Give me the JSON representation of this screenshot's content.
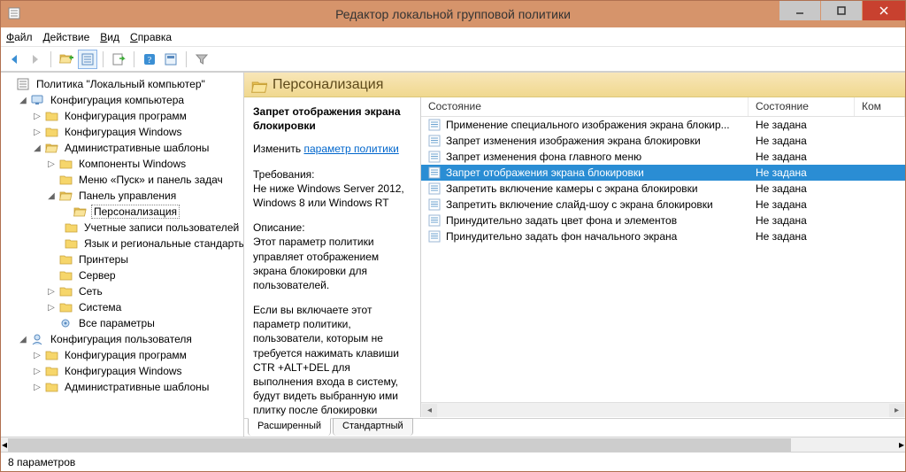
{
  "window": {
    "title": "Редактор локальной групповой политики"
  },
  "menu": {
    "file": "Файл",
    "action": "Действие",
    "view": "Вид",
    "help": "Справка"
  },
  "tree": {
    "root": "Политика \"Локальный компьютер\"",
    "compCfg": "Конфигурация компьютера",
    "softCfg": "Конфигурация программ",
    "winCfg": "Конфигурация Windows",
    "adminTpl": "Административные шаблоны",
    "winComp": "Компоненты Windows",
    "startMenu": "Меню «Пуск» и панель задач",
    "ctrlPanel": "Панель управления",
    "personalization": "Персонализация",
    "userAccounts": "Учетные записи пользователей",
    "langRegion": "Язык и региональные стандарты",
    "printers": "Принтеры",
    "server": "Сервер",
    "network": "Сеть",
    "system": "Система",
    "allSettings": "Все параметры",
    "userCfg": "Конфигурация пользователя",
    "uSoftCfg": "Конфигурация программ",
    "uWinCfg": "Конфигурация Windows",
    "uAdminTpl": "Административные шаблоны"
  },
  "header": {
    "title": "Персонализация"
  },
  "details": {
    "settingName": "Запрет отображения экрана блокировки",
    "editPrefix": "Изменить ",
    "editLink": "параметр политики",
    "reqLabel": "Требования:",
    "reqText": "Не ниже Windows Server 2012, Windows 8 или Windows RT",
    "descLabel": "Описание:",
    "descP1": "Этот параметр политики управляет отображением экрана блокировки для пользователей.",
    "descP2": "Если вы включаете этот параметр политики, пользователи, которым не требуется нажимать клавиши CTR +ALT+DEL для выполнения входа в систему, будут видеть выбранную ими плитку после блокировки своего компьютера."
  },
  "columns": {
    "name": "Состояние",
    "state": "Состояние",
    "comment": "Комментарий",
    "commentShort": "Ком"
  },
  "rows": [
    {
      "name": "Применение специального изображения экрана блокир...",
      "state": "Не задана",
      "selected": false
    },
    {
      "name": "Запрет изменения изображения экрана блокировки",
      "state": "Не задана",
      "selected": false
    },
    {
      "name": "Запрет изменения фона главного меню",
      "state": "Не задана",
      "selected": false
    },
    {
      "name": "Запрет отображения экрана блокировки",
      "state": "Не задана",
      "selected": true
    },
    {
      "name": "Запретить включение камеры с экрана блокировки",
      "state": "Не задана",
      "selected": false
    },
    {
      "name": "Запретить включение слайд-шоу с экрана блокировки",
      "state": "Не задана",
      "selected": false
    },
    {
      "name": "Принудительно задать цвет фона и элементов",
      "state": "Не задана",
      "selected": false
    },
    {
      "name": "Принудительно задать фон начального экрана",
      "state": "Не задана",
      "selected": false
    }
  ],
  "tabs": {
    "extended": "Расширенный",
    "standard": "Стандартный"
  },
  "status": {
    "text": "8 параметров"
  }
}
